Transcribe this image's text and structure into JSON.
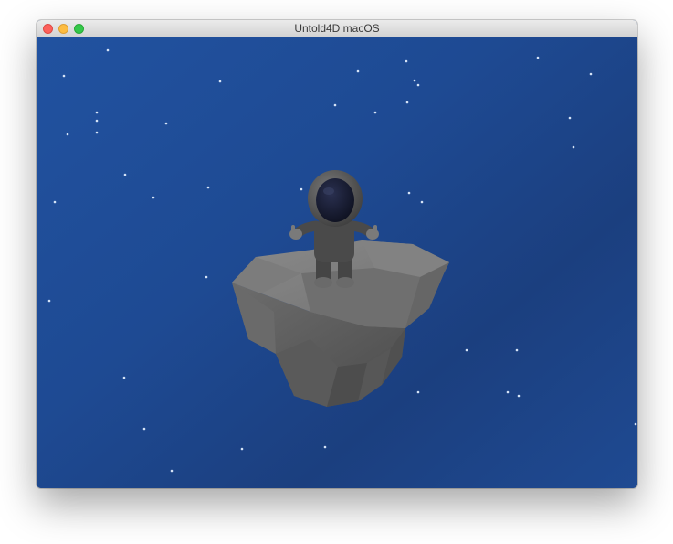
{
  "window": {
    "title": "Untold4D macOS",
    "buttons": [
      "close",
      "minimize",
      "zoom"
    ]
  },
  "scene": {
    "background_color": "#1e4a93",
    "star_color": "#cfe0f5",
    "rock_color": "#5a5a5a",
    "astronaut_suit_color": "#4a4a4a",
    "visor_color": "#15192a"
  }
}
